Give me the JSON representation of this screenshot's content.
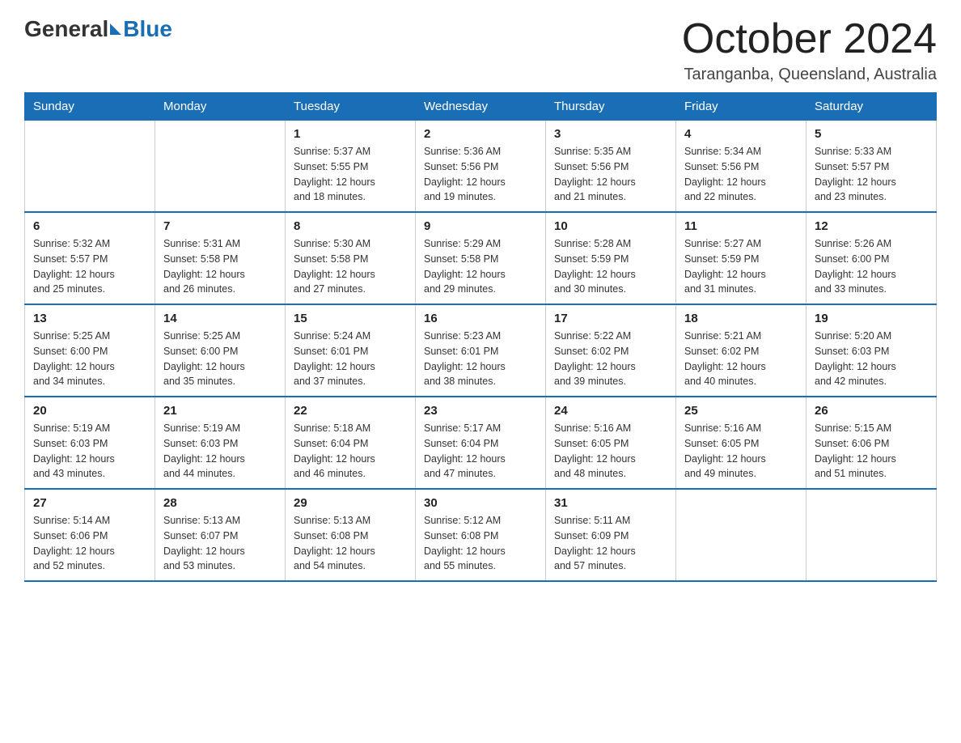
{
  "header": {
    "logo_general": "General",
    "logo_blue": "Blue",
    "month_year": "October 2024",
    "location": "Taranganba, Queensland, Australia"
  },
  "days_of_week": [
    "Sunday",
    "Monday",
    "Tuesday",
    "Wednesday",
    "Thursday",
    "Friday",
    "Saturday"
  ],
  "weeks": [
    [
      {
        "day": "",
        "info": ""
      },
      {
        "day": "",
        "info": ""
      },
      {
        "day": "1",
        "info": "Sunrise: 5:37 AM\nSunset: 5:55 PM\nDaylight: 12 hours\nand 18 minutes."
      },
      {
        "day": "2",
        "info": "Sunrise: 5:36 AM\nSunset: 5:56 PM\nDaylight: 12 hours\nand 19 minutes."
      },
      {
        "day": "3",
        "info": "Sunrise: 5:35 AM\nSunset: 5:56 PM\nDaylight: 12 hours\nand 21 minutes."
      },
      {
        "day": "4",
        "info": "Sunrise: 5:34 AM\nSunset: 5:56 PM\nDaylight: 12 hours\nand 22 minutes."
      },
      {
        "day": "5",
        "info": "Sunrise: 5:33 AM\nSunset: 5:57 PM\nDaylight: 12 hours\nand 23 minutes."
      }
    ],
    [
      {
        "day": "6",
        "info": "Sunrise: 5:32 AM\nSunset: 5:57 PM\nDaylight: 12 hours\nand 25 minutes."
      },
      {
        "day": "7",
        "info": "Sunrise: 5:31 AM\nSunset: 5:58 PM\nDaylight: 12 hours\nand 26 minutes."
      },
      {
        "day": "8",
        "info": "Sunrise: 5:30 AM\nSunset: 5:58 PM\nDaylight: 12 hours\nand 27 minutes."
      },
      {
        "day": "9",
        "info": "Sunrise: 5:29 AM\nSunset: 5:58 PM\nDaylight: 12 hours\nand 29 minutes."
      },
      {
        "day": "10",
        "info": "Sunrise: 5:28 AM\nSunset: 5:59 PM\nDaylight: 12 hours\nand 30 minutes."
      },
      {
        "day": "11",
        "info": "Sunrise: 5:27 AM\nSunset: 5:59 PM\nDaylight: 12 hours\nand 31 minutes."
      },
      {
        "day": "12",
        "info": "Sunrise: 5:26 AM\nSunset: 6:00 PM\nDaylight: 12 hours\nand 33 minutes."
      }
    ],
    [
      {
        "day": "13",
        "info": "Sunrise: 5:25 AM\nSunset: 6:00 PM\nDaylight: 12 hours\nand 34 minutes."
      },
      {
        "day": "14",
        "info": "Sunrise: 5:25 AM\nSunset: 6:00 PM\nDaylight: 12 hours\nand 35 minutes."
      },
      {
        "day": "15",
        "info": "Sunrise: 5:24 AM\nSunset: 6:01 PM\nDaylight: 12 hours\nand 37 minutes."
      },
      {
        "day": "16",
        "info": "Sunrise: 5:23 AM\nSunset: 6:01 PM\nDaylight: 12 hours\nand 38 minutes."
      },
      {
        "day": "17",
        "info": "Sunrise: 5:22 AM\nSunset: 6:02 PM\nDaylight: 12 hours\nand 39 minutes."
      },
      {
        "day": "18",
        "info": "Sunrise: 5:21 AM\nSunset: 6:02 PM\nDaylight: 12 hours\nand 40 minutes."
      },
      {
        "day": "19",
        "info": "Sunrise: 5:20 AM\nSunset: 6:03 PM\nDaylight: 12 hours\nand 42 minutes."
      }
    ],
    [
      {
        "day": "20",
        "info": "Sunrise: 5:19 AM\nSunset: 6:03 PM\nDaylight: 12 hours\nand 43 minutes."
      },
      {
        "day": "21",
        "info": "Sunrise: 5:19 AM\nSunset: 6:03 PM\nDaylight: 12 hours\nand 44 minutes."
      },
      {
        "day": "22",
        "info": "Sunrise: 5:18 AM\nSunset: 6:04 PM\nDaylight: 12 hours\nand 46 minutes."
      },
      {
        "day": "23",
        "info": "Sunrise: 5:17 AM\nSunset: 6:04 PM\nDaylight: 12 hours\nand 47 minutes."
      },
      {
        "day": "24",
        "info": "Sunrise: 5:16 AM\nSunset: 6:05 PM\nDaylight: 12 hours\nand 48 minutes."
      },
      {
        "day": "25",
        "info": "Sunrise: 5:16 AM\nSunset: 6:05 PM\nDaylight: 12 hours\nand 49 minutes."
      },
      {
        "day": "26",
        "info": "Sunrise: 5:15 AM\nSunset: 6:06 PM\nDaylight: 12 hours\nand 51 minutes."
      }
    ],
    [
      {
        "day": "27",
        "info": "Sunrise: 5:14 AM\nSunset: 6:06 PM\nDaylight: 12 hours\nand 52 minutes."
      },
      {
        "day": "28",
        "info": "Sunrise: 5:13 AM\nSunset: 6:07 PM\nDaylight: 12 hours\nand 53 minutes."
      },
      {
        "day": "29",
        "info": "Sunrise: 5:13 AM\nSunset: 6:08 PM\nDaylight: 12 hours\nand 54 minutes."
      },
      {
        "day": "30",
        "info": "Sunrise: 5:12 AM\nSunset: 6:08 PM\nDaylight: 12 hours\nand 55 minutes."
      },
      {
        "day": "31",
        "info": "Sunrise: 5:11 AM\nSunset: 6:09 PM\nDaylight: 12 hours\nand 57 minutes."
      },
      {
        "day": "",
        "info": ""
      },
      {
        "day": "",
        "info": ""
      }
    ]
  ]
}
